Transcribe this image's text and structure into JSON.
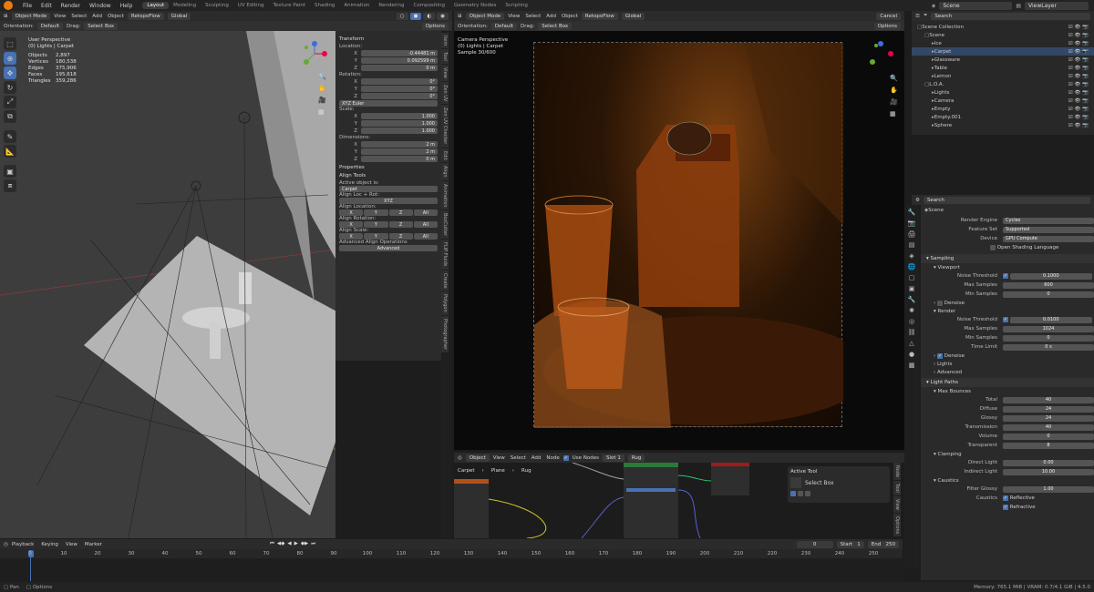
{
  "menu": [
    "File",
    "Edit",
    "Render",
    "Window",
    "Help"
  ],
  "workspaces": [
    "Layout",
    "Modeling",
    "Sculpting",
    "UV Editing",
    "Texture Paint",
    "Shading",
    "Animation",
    "Rendering",
    "Compositing",
    "Geometry Nodes",
    "Scripting"
  ],
  "scene": {
    "name": "Scene",
    "view_layer": "ViewLayer",
    "search_ph": "Search"
  },
  "vp3d": {
    "mode": "Object Mode",
    "menus": [
      "View",
      "Select",
      "Add",
      "Object"
    ],
    "addon": "RetopoFlow",
    "transform": "Global",
    "orientation_lbl": "Orientation:",
    "orientation": "Default",
    "drag_lbl": "Drag:",
    "drag": "Select Box",
    "options": "Options",
    "info": {
      "view": "User Perspective",
      "context": "(0) Lights | Carpet",
      "stats": [
        [
          "Objects",
          "2,897"
        ],
        [
          "Vertices",
          "180,538"
        ],
        [
          "Edges",
          "375,906"
        ],
        [
          "Faces",
          "195,618"
        ],
        [
          "Triangles",
          "359,286"
        ]
      ]
    }
  },
  "npanel": {
    "transform": "Transform",
    "location": "Location:",
    "loc": [
      "-0.44481 m",
      "0.092599 m",
      "0 m"
    ],
    "rotation": "Rotation:",
    "rot": [
      "0°",
      "0°",
      "0°"
    ],
    "rotmode": "XYZ Euler",
    "scale": "Scale:",
    "scl": [
      "1.000",
      "1.000",
      "1.000"
    ],
    "dimensions": "Dimensions:",
    "dim": [
      "2 m",
      "2 m",
      "0 m"
    ],
    "properties": "Properties",
    "align_tools": "Align Tools",
    "active_lbl": "Active object is:",
    "active_obj": "Carpet",
    "align_loc_rot": "Align Loc + Rot:",
    "xyz": "XYZ",
    "align_location": "Align Location:",
    "align_rotation": "Align Rotation:",
    "align_scale": "Align Scale:",
    "adv_ops": "Advanced Align Operations",
    "advanced": "Advanced",
    "axes": [
      "X",
      "Y",
      "Z",
      "All"
    ],
    "axis_labels": [
      "X",
      "Y",
      "Z"
    ],
    "tabs": [
      "Item",
      "Tool",
      "View",
      "Zen UV",
      "Zen UV Checker",
      "Edit",
      "Align",
      "Animation",
      "BoxCutter",
      "FLIP Fluids",
      "Create",
      "Polygon",
      "Photographer"
    ]
  },
  "vp_render": {
    "mode": "Object Mode",
    "menus": [
      "View",
      "Select",
      "Add",
      "Object"
    ],
    "addon": "RetopoFlow",
    "transform": "Global",
    "orientation_lbl": "Orientation:",
    "orientation": "Default",
    "drag_lbl": "Drag:",
    "drag": "Select Box",
    "options": "Options",
    "cancel": "Cancel",
    "view": "Camera Perspective",
    "context": "(0) Lights | Carpet",
    "sample": "Sample 30/600"
  },
  "node": {
    "type": "Object",
    "menus": [
      "View",
      "Select",
      "Add",
      "Node"
    ],
    "use_nodes": "Use Nodes",
    "slot": "Slot 1",
    "material": "Rug",
    "crumbs": [
      "Carpet",
      "Plane",
      "Rug"
    ],
    "active_tool": "Active Tool",
    "select_box": "Select Box",
    "tabs": [
      "Node",
      "Tool",
      "View",
      "Options"
    ]
  },
  "outliner": {
    "search_ph": "Search",
    "rows": [
      {
        "name": "Scene Collection",
        "indent": 0
      },
      {
        "name": "Scene",
        "indent": 1
      },
      {
        "name": "Ice",
        "indent": 2
      },
      {
        "name": "Carpet",
        "indent": 2
      },
      {
        "name": "Glassware",
        "indent": 2
      },
      {
        "name": "Table",
        "indent": 2
      },
      {
        "name": "Lemon",
        "indent": 2
      },
      {
        "name": "L.O.A.",
        "indent": 1
      },
      {
        "name": "Lights",
        "indent": 2
      },
      {
        "name": "Camera",
        "indent": 2
      },
      {
        "name": "Empty",
        "indent": 2
      },
      {
        "name": "Empty.001",
        "indent": 2
      },
      {
        "name": "Sphere",
        "indent": 2
      }
    ]
  },
  "props": {
    "search_ph": "Search",
    "scene": "Scene",
    "render_engine_lbl": "Render Engine",
    "render_engine": "Cycles",
    "feature_set_lbl": "Feature Set",
    "feature_set": "Supported",
    "device_lbl": "Device",
    "device": "GPU Compute",
    "osl": "Open Shading Language",
    "sampling": "Sampling",
    "viewport": "Viewport",
    "noise_thr": "Noise Threshold",
    "vp_noise": "0.1000",
    "max_samples": "Max Samples",
    "vp_max": "600",
    "min_samples": "Min Samples",
    "vp_min": "0",
    "denoise": "Denoise",
    "render": "Render",
    "r_noise": "0.0100",
    "r_max": "1024",
    "r_min": "0",
    "time_limit": "Time Limit",
    "r_time": "0 s",
    "r_denoise": "Denoise",
    "lights": "Lights",
    "advanced": "Advanced",
    "light_paths": "Light Paths",
    "max_bounces": "Max Bounces",
    "bounces": [
      [
        "Total",
        "40"
      ],
      [
        "Diffuse",
        "24"
      ],
      [
        "Glossy",
        "24"
      ],
      [
        "Transmission",
        "40"
      ],
      [
        "Volume",
        "0"
      ],
      [
        "Transparent",
        "8"
      ]
    ],
    "clamping": "Clamping",
    "direct": "Direct Light",
    "direct_v": "0.00",
    "indirect": "Indirect Light",
    "indirect_v": "10.00",
    "caustics": "Caustics",
    "filter_glossy": "Filter Glossy",
    "filter_v": "1.00",
    "caustics_lbl": "Caustics",
    "reflective": "Reflective",
    "refractive": "Refractive"
  },
  "timeline": {
    "menus": [
      "Playback",
      "Keying",
      "View",
      "Marker"
    ],
    "frame": "0",
    "start_lbl": "Start",
    "start": "1",
    "end_lbl": "End",
    "end": "250",
    "ticks": [
      "0",
      "10",
      "20",
      "30",
      "40",
      "50",
      "60",
      "70",
      "80",
      "90",
      "100",
      "110",
      "120",
      "130",
      "140",
      "150",
      "160",
      "170",
      "180",
      "190",
      "200",
      "210",
      "220",
      "230",
      "240",
      "250"
    ]
  },
  "status": {
    "pan": "Pan",
    "options": "Options",
    "memory": "Memory: 765.1 MiB | VRAM: 0.7/4.1 GiB | 4.5.0"
  },
  "colors": {
    "accent": "#4772b3",
    "orange": "#e87d0d"
  }
}
